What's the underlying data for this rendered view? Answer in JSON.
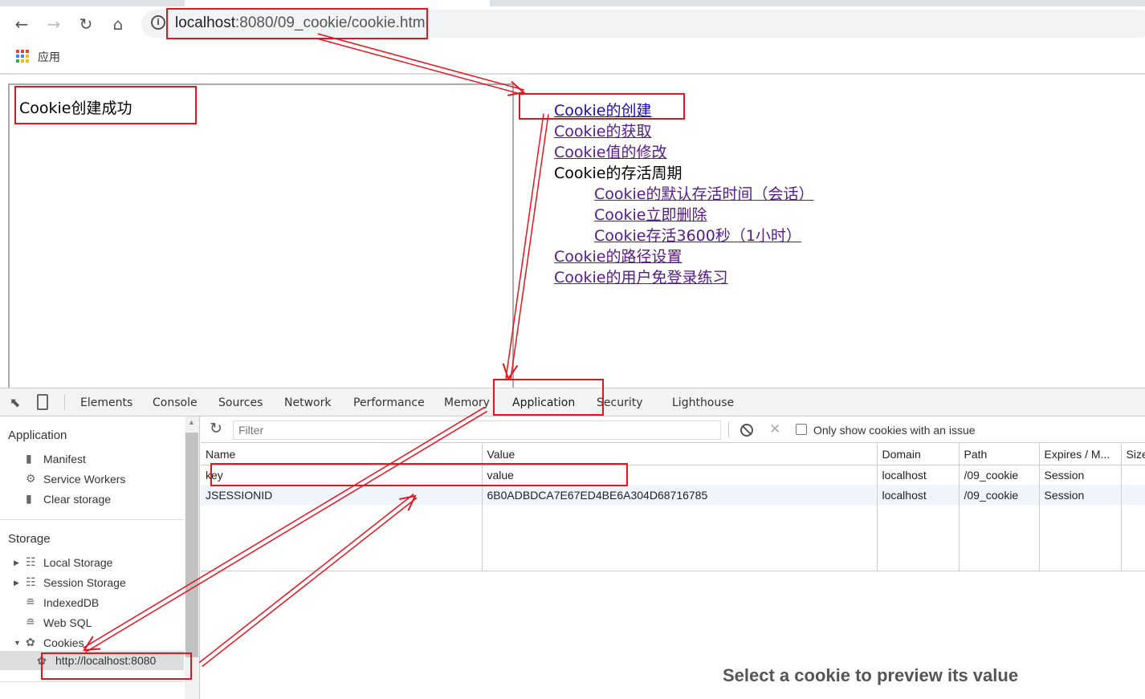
{
  "browser": {
    "url_host": "localhost",
    "url_rest": ":8080/09_cookie/cookie.html",
    "bookmark_apps": "应用"
  },
  "page": {
    "message": "Cookie创建成功",
    "links": [
      {
        "label": "Cookie的创建",
        "link": true
      },
      {
        "label": "Cookie的获取",
        "link": true
      },
      {
        "label": "Cookie值的修改",
        "link": true
      },
      {
        "label": "Cookie的存活周期",
        "link": false
      },
      {
        "label": "Cookie的默认存活时间（会话）",
        "link": true,
        "indent": true
      },
      {
        "label": "Cookie立即删除",
        "link": true,
        "indent": true
      },
      {
        "label": "Cookie存活3600秒（1小时）",
        "link": true,
        "indent": true
      },
      {
        "label": "Cookie的路径设置",
        "link": true
      },
      {
        "label": "Cookie的用户免登录练习",
        "link": true
      }
    ]
  },
  "devtools": {
    "tabs": [
      "Elements",
      "Console",
      "Sources",
      "Network",
      "Performance",
      "Memory",
      "Application",
      "Security",
      "Lighthouse"
    ],
    "active_tab": "Application",
    "sidebar": {
      "application_header": "Application",
      "application_items": [
        "Manifest",
        "Service Workers",
        "Clear storage"
      ],
      "storage_header": "Storage",
      "storage_items": [
        "Local Storage",
        "Session Storage",
        "IndexedDB",
        "Web SQL",
        "Cookies"
      ],
      "cookie_origin": "http://localhost:8080"
    },
    "filter_placeholder": "Filter",
    "only_issue_label": "Only show cookies with an issue",
    "columns": [
      "Name",
      "Value",
      "Domain",
      "Path",
      "Expires / M...",
      "Size"
    ],
    "rows": [
      [
        "key",
        "value",
        "localhost",
        "/09_cookie",
        "Session",
        ""
      ],
      [
        "JSESSIONID",
        "6B0ADBDCA7E67ED4BE6A304D68716785",
        "localhost",
        "/09_cookie",
        "Session",
        ""
      ]
    ],
    "preview_text": "Select a cookie to preview its value"
  },
  "annotation_color": "#e8131f"
}
